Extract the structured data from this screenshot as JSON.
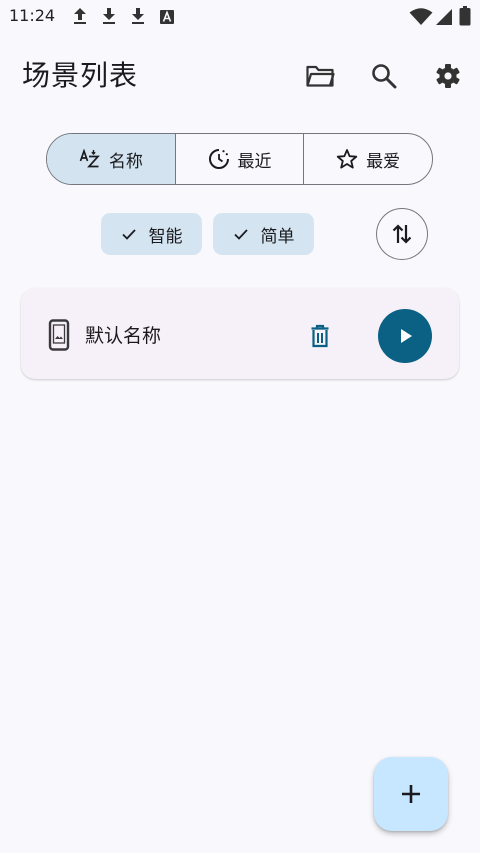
{
  "status_bar": {
    "time": "11:24",
    "notification_icons": [
      "upload-icon",
      "download-icon",
      "download-icon",
      "a-box-icon"
    ],
    "system_icons": [
      "wifi-icon",
      "signal-icon",
      "battery-icon"
    ]
  },
  "app_bar": {
    "title": "场景列表",
    "actions": [
      "folder-icon",
      "search-icon",
      "settings-icon"
    ]
  },
  "sort_segments": [
    {
      "label": "名称",
      "icon": "sort-az-icon",
      "selected": true
    },
    {
      "label": "最近",
      "icon": "history-icon",
      "selected": false
    },
    {
      "label": "最爱",
      "icon": "star-icon",
      "selected": false
    }
  ],
  "filter_chips": [
    {
      "label": "智能",
      "checked": true
    },
    {
      "label": "简单",
      "checked": true
    }
  ],
  "sort_direction_icon": "swap-vert-icon",
  "scenes": [
    {
      "name": "默认名称",
      "icon": "phone-icon"
    }
  ],
  "fab_icon": "add-icon",
  "colors": {
    "background": "#f9f9fd",
    "selected_segment": "#d3e4f0",
    "chip": "#d4e5f1",
    "card": "#f6f1f8",
    "accent": "#0a6184",
    "fab": "#c6e7ff"
  }
}
